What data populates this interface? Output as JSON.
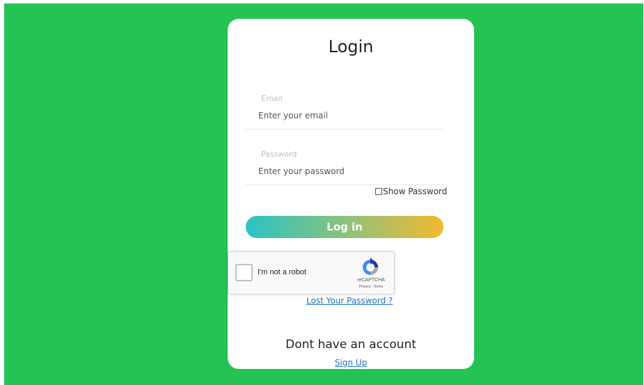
{
  "login": {
    "title": "Login",
    "email_label": "Email",
    "email_placeholder": "Enter your email",
    "password_label": "Password",
    "password_placeholder": "Enter your password",
    "show_password_label": "Show Password",
    "submit_label": "Log in",
    "lost_password_link": "Lost Your Password ?",
    "no_account_text": "Dont have an account",
    "signup_link": "Sign Up"
  },
  "recaptcha": {
    "label": "I'm not a robot",
    "brand": "reCAPTCHA",
    "terms": "Privacy - Terms"
  },
  "colors": {
    "background": "#24c353",
    "button_gradient_start": "#2bc3c4",
    "button_gradient_end": "#f4b92f",
    "link": "#1a73c8"
  }
}
